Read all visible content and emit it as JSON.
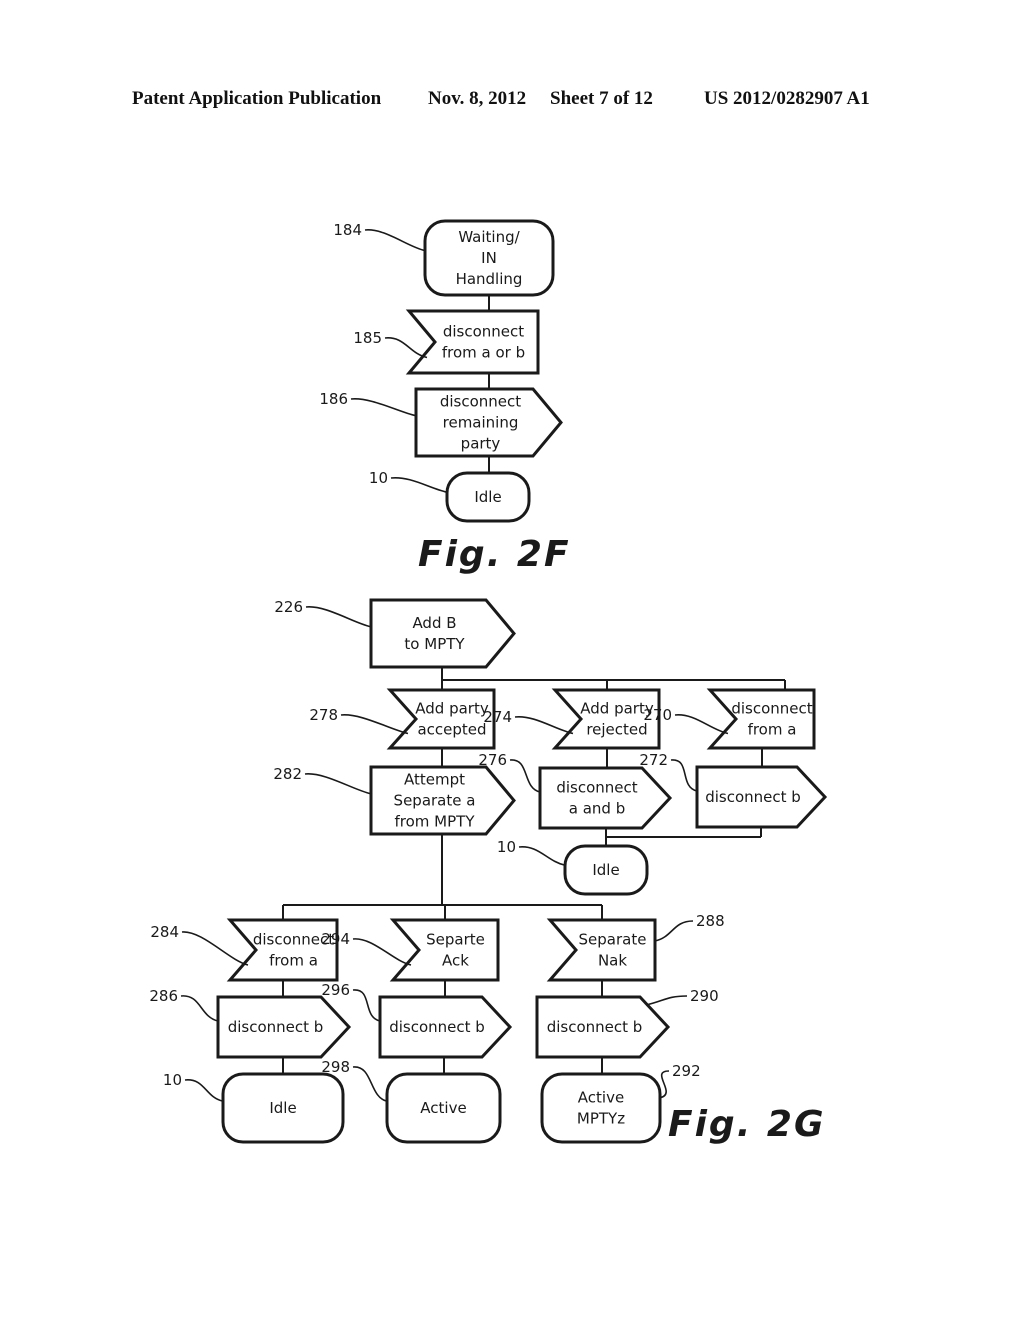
{
  "header": {
    "publication": "Patent Application Publication",
    "date": "Nov. 8, 2012",
    "sheet": "Sheet 7 of 12",
    "number": "US 2012/0282907 A1"
  },
  "figures": [
    {
      "id": "fig2f",
      "caption": "Fig. 2F",
      "nodes": [
        {
          "key": "n184",
          "ref": "184",
          "type": "state",
          "lines": [
            "Waiting/",
            "IN",
            "Handling"
          ]
        },
        {
          "key": "n185",
          "ref": "185",
          "type": "input",
          "lines": [
            "disconnect",
            "from a or b"
          ]
        },
        {
          "key": "n186",
          "ref": "186",
          "type": "output",
          "lines": [
            "disconnect",
            "remaining",
            "party"
          ]
        },
        {
          "key": "n10a",
          "ref": "10",
          "type": "state",
          "lines": [
            "Idle"
          ]
        }
      ]
    },
    {
      "id": "fig2g",
      "caption": "Fig. 2G",
      "nodes": [
        {
          "key": "n226",
          "ref": "226",
          "type": "output",
          "lines": [
            "Add B",
            "to MPTY"
          ]
        },
        {
          "key": "n278",
          "ref": "278",
          "type": "input",
          "lines": [
            "Add party",
            "accepted"
          ]
        },
        {
          "key": "n274",
          "ref": "274",
          "type": "input",
          "lines": [
            "Add party",
            "rejected"
          ]
        },
        {
          "key": "n270",
          "ref": "270",
          "type": "input",
          "lines": [
            "disconnect",
            "from a"
          ]
        },
        {
          "key": "n282",
          "ref": "282",
          "type": "output",
          "lines": [
            "Attempt",
            "Separate a",
            "from MPTY"
          ]
        },
        {
          "key": "n276",
          "ref": "276",
          "type": "output",
          "lines": [
            "disconnect",
            "a and b"
          ]
        },
        {
          "key": "n272",
          "ref": "272",
          "type": "output",
          "lines": [
            "disconnect b"
          ]
        },
        {
          "key": "n10b",
          "ref": "10",
          "type": "state",
          "lines": [
            "Idle"
          ]
        },
        {
          "key": "n284",
          "ref": "284",
          "type": "input",
          "lines": [
            "disconnect",
            "from a"
          ]
        },
        {
          "key": "n294",
          "ref": "294",
          "type": "input",
          "lines": [
            "Separte",
            "Ack"
          ]
        },
        {
          "key": "n288",
          "ref": "288",
          "type": "input",
          "lines": [
            "Separate",
            "Nak"
          ]
        },
        {
          "key": "n286",
          "ref": "286",
          "type": "output",
          "lines": [
            "disconnect b"
          ]
        },
        {
          "key": "n296",
          "ref": "296",
          "type": "output",
          "lines": [
            "disconnect b"
          ]
        },
        {
          "key": "n290",
          "ref": "290",
          "type": "output",
          "lines": [
            "disconnect b"
          ]
        },
        {
          "key": "n10c",
          "ref": "10",
          "type": "state",
          "lines": [
            "Idle"
          ]
        },
        {
          "key": "n298",
          "ref": "298",
          "type": "state",
          "lines": [
            "Active"
          ]
        },
        {
          "key": "n292",
          "ref": "292",
          "type": "state",
          "lines": [
            "Active",
            "MPTYz"
          ]
        }
      ]
    }
  ]
}
